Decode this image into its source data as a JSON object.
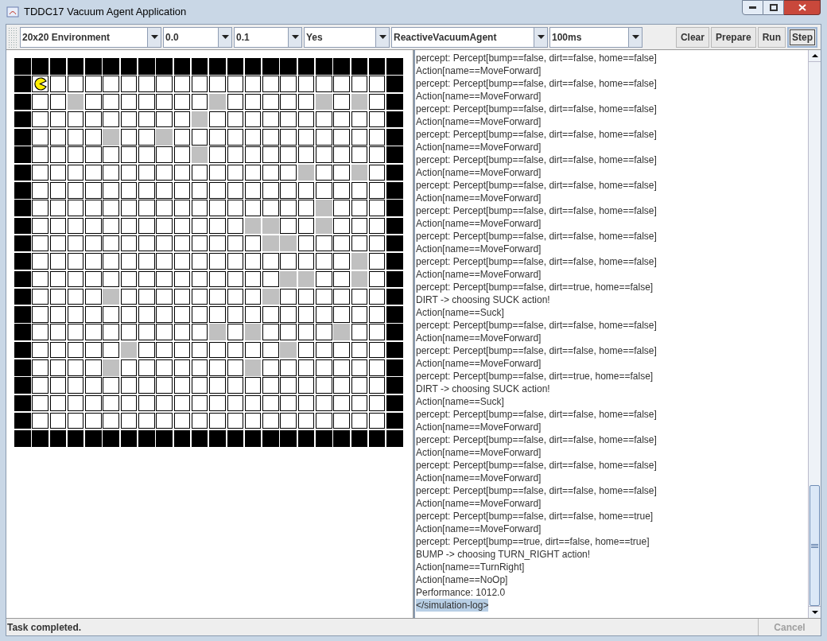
{
  "window": {
    "title": "TDDC17 Vacuum Agent Application"
  },
  "toolbar": {
    "dropdowns": [
      "20x20 Environment",
      "0.0",
      "0.1",
      "Yes",
      "ReactiveVacuumAgent",
      "100ms"
    ],
    "buttons": [
      {
        "label": "Clear",
        "focused": false
      },
      {
        "label": "Prepare",
        "focused": false
      },
      {
        "label": "Run",
        "focused": false
      },
      {
        "label": "Step",
        "focused": true
      }
    ]
  },
  "grid": {
    "rows": [
      [
        {
          "kind": "agent"
        },
        {
          "kind": "floor"
        },
        {
          "kind": "floor"
        },
        {
          "kind": "floor"
        },
        {
          "kind": "floor"
        },
        {
          "kind": "floor"
        },
        {
          "kind": "floor"
        },
        {
          "kind": "floor"
        },
        {
          "kind": "floor"
        },
        {
          "kind": "floor"
        },
        {
          "kind": "floor"
        },
        {
          "kind": "floor"
        },
        {
          "kind": "floor"
        },
        {
          "kind": "floor"
        },
        {
          "kind": "floor"
        },
        {
          "kind": "floor"
        },
        {
          "kind": "floor"
        },
        {
          "kind": "floor"
        },
        {
          "kind": "floor"
        },
        {
          "kind": "floor"
        }
      ],
      [
        {
          "kind": "floor"
        },
        {
          "kind": "floor"
        },
        {
          "kind": "dirt"
        },
        {
          "kind": "floor"
        },
        {
          "kind": "floor"
        },
        {
          "kind": "floor"
        },
        {
          "kind": "floor"
        },
        {
          "kind": "floor"
        },
        {
          "kind": "floor"
        },
        {
          "kind": "floor"
        },
        {
          "kind": "dirt"
        },
        {
          "kind": "floor"
        },
        {
          "kind": "floor"
        },
        {
          "kind": "floor"
        },
        {
          "kind": "floor"
        },
        {
          "kind": "floor"
        },
        {
          "kind": "dirt"
        },
        {
          "kind": "floor"
        },
        {
          "kind": "dirt"
        },
        {
          "kind": "floor"
        }
      ],
      [
        {
          "kind": "floor"
        },
        {
          "kind": "floor"
        },
        {
          "kind": "floor"
        },
        {
          "kind": "floor"
        },
        {
          "kind": "floor"
        },
        {
          "kind": "floor"
        },
        {
          "kind": "floor"
        },
        {
          "kind": "floor"
        },
        {
          "kind": "floor"
        },
        {
          "kind": "dirt"
        },
        {
          "kind": "floor"
        },
        {
          "kind": "floor"
        },
        {
          "kind": "floor"
        },
        {
          "kind": "floor"
        },
        {
          "kind": "floor"
        },
        {
          "kind": "floor"
        },
        {
          "kind": "floor"
        },
        {
          "kind": "floor"
        },
        {
          "kind": "floor"
        },
        {
          "kind": "floor"
        }
      ],
      [
        {
          "kind": "floor"
        },
        {
          "kind": "floor"
        },
        {
          "kind": "floor"
        },
        {
          "kind": "floor"
        },
        {
          "kind": "dirt"
        },
        {
          "kind": "floor"
        },
        {
          "kind": "floor"
        },
        {
          "kind": "dirt"
        },
        {
          "kind": "floor"
        },
        {
          "kind": "floor"
        },
        {
          "kind": "floor"
        },
        {
          "kind": "floor"
        },
        {
          "kind": "floor"
        },
        {
          "kind": "floor"
        },
        {
          "kind": "floor"
        },
        {
          "kind": "floor"
        },
        {
          "kind": "floor"
        },
        {
          "kind": "floor"
        },
        {
          "kind": "floor"
        },
        {
          "kind": "floor"
        }
      ],
      [
        {
          "kind": "floor"
        },
        {
          "kind": "floor"
        },
        {
          "kind": "floor"
        },
        {
          "kind": "floor"
        },
        {
          "kind": "floor"
        },
        {
          "kind": "floor"
        },
        {
          "kind": "floor"
        },
        {
          "kind": "floor"
        },
        {
          "kind": "floor"
        },
        {
          "kind": "dirt"
        },
        {
          "kind": "floor"
        },
        {
          "kind": "floor"
        },
        {
          "kind": "floor"
        },
        {
          "kind": "floor"
        },
        {
          "kind": "floor"
        },
        {
          "kind": "floor"
        },
        {
          "kind": "floor"
        },
        {
          "kind": "floor"
        },
        {
          "kind": "floor"
        },
        {
          "kind": "floor"
        }
      ],
      [
        {
          "kind": "floor"
        },
        {
          "kind": "floor"
        },
        {
          "kind": "floor"
        },
        {
          "kind": "floor"
        },
        {
          "kind": "floor"
        },
        {
          "kind": "floor"
        },
        {
          "kind": "floor"
        },
        {
          "kind": "floor"
        },
        {
          "kind": "floor"
        },
        {
          "kind": "floor"
        },
        {
          "kind": "floor"
        },
        {
          "kind": "floor"
        },
        {
          "kind": "floor"
        },
        {
          "kind": "floor"
        },
        {
          "kind": "floor"
        },
        {
          "kind": "dirt"
        },
        {
          "kind": "floor"
        },
        {
          "kind": "floor"
        },
        {
          "kind": "dirt"
        },
        {
          "kind": "floor"
        }
      ],
      [
        {
          "kind": "floor"
        },
        {
          "kind": "floor"
        },
        {
          "kind": "floor"
        },
        {
          "kind": "floor"
        },
        {
          "kind": "floor"
        },
        {
          "kind": "floor"
        },
        {
          "kind": "floor"
        },
        {
          "kind": "floor"
        },
        {
          "kind": "floor"
        },
        {
          "kind": "floor"
        },
        {
          "kind": "floor"
        },
        {
          "kind": "floor"
        },
        {
          "kind": "floor"
        },
        {
          "kind": "floor"
        },
        {
          "kind": "floor"
        },
        {
          "kind": "floor"
        },
        {
          "kind": "floor"
        },
        {
          "kind": "floor"
        },
        {
          "kind": "floor"
        },
        {
          "kind": "floor"
        }
      ],
      [
        {
          "kind": "floor"
        },
        {
          "kind": "floor"
        },
        {
          "kind": "floor"
        },
        {
          "kind": "floor"
        },
        {
          "kind": "floor"
        },
        {
          "kind": "floor"
        },
        {
          "kind": "floor"
        },
        {
          "kind": "floor"
        },
        {
          "kind": "floor"
        },
        {
          "kind": "floor"
        },
        {
          "kind": "floor"
        },
        {
          "kind": "floor"
        },
        {
          "kind": "floor"
        },
        {
          "kind": "floor"
        },
        {
          "kind": "floor"
        },
        {
          "kind": "floor"
        },
        {
          "kind": "dirt"
        },
        {
          "kind": "floor"
        },
        {
          "kind": "floor"
        },
        {
          "kind": "floor"
        }
      ],
      [
        {
          "kind": "floor"
        },
        {
          "kind": "floor"
        },
        {
          "kind": "floor"
        },
        {
          "kind": "floor"
        },
        {
          "kind": "floor"
        },
        {
          "kind": "floor"
        },
        {
          "kind": "floor"
        },
        {
          "kind": "floor"
        },
        {
          "kind": "floor"
        },
        {
          "kind": "floor"
        },
        {
          "kind": "floor"
        },
        {
          "kind": "floor"
        },
        {
          "kind": "dirt"
        },
        {
          "kind": "dirt"
        },
        {
          "kind": "floor"
        },
        {
          "kind": "floor"
        },
        {
          "kind": "dirt"
        },
        {
          "kind": "floor"
        },
        {
          "kind": "floor"
        },
        {
          "kind": "floor"
        }
      ],
      [
        {
          "kind": "floor"
        },
        {
          "kind": "floor"
        },
        {
          "kind": "floor"
        },
        {
          "kind": "floor"
        },
        {
          "kind": "floor"
        },
        {
          "kind": "floor"
        },
        {
          "kind": "floor"
        },
        {
          "kind": "floor"
        },
        {
          "kind": "floor"
        },
        {
          "kind": "floor"
        },
        {
          "kind": "floor"
        },
        {
          "kind": "floor"
        },
        {
          "kind": "floor"
        },
        {
          "kind": "dirt"
        },
        {
          "kind": "dirt"
        },
        {
          "kind": "floor"
        },
        {
          "kind": "floor"
        },
        {
          "kind": "floor"
        },
        {
          "kind": "floor"
        },
        {
          "kind": "floor"
        }
      ],
      [
        {
          "kind": "floor"
        },
        {
          "kind": "floor"
        },
        {
          "kind": "floor"
        },
        {
          "kind": "floor"
        },
        {
          "kind": "floor"
        },
        {
          "kind": "floor"
        },
        {
          "kind": "floor"
        },
        {
          "kind": "floor"
        },
        {
          "kind": "floor"
        },
        {
          "kind": "floor"
        },
        {
          "kind": "floor"
        },
        {
          "kind": "floor"
        },
        {
          "kind": "floor"
        },
        {
          "kind": "floor"
        },
        {
          "kind": "floor"
        },
        {
          "kind": "floor"
        },
        {
          "kind": "floor"
        },
        {
          "kind": "floor"
        },
        {
          "kind": "dirt"
        },
        {
          "kind": "floor"
        }
      ],
      [
        {
          "kind": "floor"
        },
        {
          "kind": "floor"
        },
        {
          "kind": "floor"
        },
        {
          "kind": "floor"
        },
        {
          "kind": "floor"
        },
        {
          "kind": "floor"
        },
        {
          "kind": "floor"
        },
        {
          "kind": "floor"
        },
        {
          "kind": "floor"
        },
        {
          "kind": "floor"
        },
        {
          "kind": "floor"
        },
        {
          "kind": "floor"
        },
        {
          "kind": "floor"
        },
        {
          "kind": "floor"
        },
        {
          "kind": "dirt"
        },
        {
          "kind": "dirt"
        },
        {
          "kind": "floor"
        },
        {
          "kind": "floor"
        },
        {
          "kind": "dirt"
        },
        {
          "kind": "floor"
        }
      ],
      [
        {
          "kind": "floor"
        },
        {
          "kind": "floor"
        },
        {
          "kind": "floor"
        },
        {
          "kind": "floor"
        },
        {
          "kind": "dirt"
        },
        {
          "kind": "floor"
        },
        {
          "kind": "floor"
        },
        {
          "kind": "floor"
        },
        {
          "kind": "floor"
        },
        {
          "kind": "floor"
        },
        {
          "kind": "floor"
        },
        {
          "kind": "floor"
        },
        {
          "kind": "floor"
        },
        {
          "kind": "dirt"
        },
        {
          "kind": "floor"
        },
        {
          "kind": "floor"
        },
        {
          "kind": "floor"
        },
        {
          "kind": "floor"
        },
        {
          "kind": "floor"
        },
        {
          "kind": "floor"
        }
      ],
      [
        {
          "kind": "floor"
        },
        {
          "kind": "floor"
        },
        {
          "kind": "floor"
        },
        {
          "kind": "floor"
        },
        {
          "kind": "floor"
        },
        {
          "kind": "floor"
        },
        {
          "kind": "floor"
        },
        {
          "kind": "floor"
        },
        {
          "kind": "floor"
        },
        {
          "kind": "floor"
        },
        {
          "kind": "floor"
        },
        {
          "kind": "floor"
        },
        {
          "kind": "floor"
        },
        {
          "kind": "floor"
        },
        {
          "kind": "floor"
        },
        {
          "kind": "floor"
        },
        {
          "kind": "floor"
        },
        {
          "kind": "floor"
        },
        {
          "kind": "floor"
        },
        {
          "kind": "floor"
        }
      ],
      [
        {
          "kind": "floor"
        },
        {
          "kind": "floor"
        },
        {
          "kind": "floor"
        },
        {
          "kind": "floor"
        },
        {
          "kind": "floor"
        },
        {
          "kind": "floor"
        },
        {
          "kind": "floor"
        },
        {
          "kind": "floor"
        },
        {
          "kind": "floor"
        },
        {
          "kind": "floor"
        },
        {
          "kind": "dirt"
        },
        {
          "kind": "floor"
        },
        {
          "kind": "dirt"
        },
        {
          "kind": "floor"
        },
        {
          "kind": "floor"
        },
        {
          "kind": "floor"
        },
        {
          "kind": "floor"
        },
        {
          "kind": "dirt"
        },
        {
          "kind": "floor"
        },
        {
          "kind": "floor"
        }
      ],
      [
        {
          "kind": "floor"
        },
        {
          "kind": "floor"
        },
        {
          "kind": "floor"
        },
        {
          "kind": "floor"
        },
        {
          "kind": "floor"
        },
        {
          "kind": "dirt"
        },
        {
          "kind": "floor"
        },
        {
          "kind": "floor"
        },
        {
          "kind": "floor"
        },
        {
          "kind": "floor"
        },
        {
          "kind": "floor"
        },
        {
          "kind": "floor"
        },
        {
          "kind": "floor"
        },
        {
          "kind": "floor"
        },
        {
          "kind": "dirt"
        },
        {
          "kind": "floor"
        },
        {
          "kind": "floor"
        },
        {
          "kind": "floor"
        },
        {
          "kind": "floor"
        },
        {
          "kind": "floor"
        }
      ],
      [
        {
          "kind": "floor"
        },
        {
          "kind": "floor"
        },
        {
          "kind": "floor"
        },
        {
          "kind": "floor"
        },
        {
          "kind": "dirt"
        },
        {
          "kind": "floor"
        },
        {
          "kind": "floor"
        },
        {
          "kind": "floor"
        },
        {
          "kind": "floor"
        },
        {
          "kind": "floor"
        },
        {
          "kind": "floor"
        },
        {
          "kind": "floor"
        },
        {
          "kind": "dirt"
        },
        {
          "kind": "floor"
        },
        {
          "kind": "floor"
        },
        {
          "kind": "floor"
        },
        {
          "kind": "floor"
        },
        {
          "kind": "floor"
        },
        {
          "kind": "floor"
        },
        {
          "kind": "floor"
        }
      ],
      [
        {
          "kind": "floor"
        },
        {
          "kind": "floor"
        },
        {
          "kind": "floor"
        },
        {
          "kind": "floor"
        },
        {
          "kind": "floor"
        },
        {
          "kind": "floor"
        },
        {
          "kind": "floor"
        },
        {
          "kind": "floor"
        },
        {
          "kind": "floor"
        },
        {
          "kind": "floor"
        },
        {
          "kind": "floor"
        },
        {
          "kind": "floor"
        },
        {
          "kind": "floor"
        },
        {
          "kind": "floor"
        },
        {
          "kind": "floor"
        },
        {
          "kind": "floor"
        },
        {
          "kind": "floor"
        },
        {
          "kind": "floor"
        },
        {
          "kind": "floor"
        },
        {
          "kind": "floor"
        }
      ],
      [
        {
          "kind": "floor"
        },
        {
          "kind": "floor"
        },
        {
          "kind": "floor"
        },
        {
          "kind": "floor"
        },
        {
          "kind": "floor"
        },
        {
          "kind": "floor"
        },
        {
          "kind": "floor"
        },
        {
          "kind": "floor"
        },
        {
          "kind": "floor"
        },
        {
          "kind": "floor"
        },
        {
          "kind": "floor"
        },
        {
          "kind": "floor"
        },
        {
          "kind": "floor"
        },
        {
          "kind": "floor"
        },
        {
          "kind": "floor"
        },
        {
          "kind": "floor"
        },
        {
          "kind": "floor"
        },
        {
          "kind": "floor"
        },
        {
          "kind": "floor"
        },
        {
          "kind": "floor"
        }
      ],
      [
        {
          "kind": "floor"
        },
        {
          "kind": "floor"
        },
        {
          "kind": "floor"
        },
        {
          "kind": "floor"
        },
        {
          "kind": "floor"
        },
        {
          "kind": "floor"
        },
        {
          "kind": "floor"
        },
        {
          "kind": "floor"
        },
        {
          "kind": "floor"
        },
        {
          "kind": "floor"
        },
        {
          "kind": "floor"
        },
        {
          "kind": "floor"
        },
        {
          "kind": "floor"
        },
        {
          "kind": "floor"
        },
        {
          "kind": "floor"
        },
        {
          "kind": "floor"
        },
        {
          "kind": "floor"
        },
        {
          "kind": "floor"
        },
        {
          "kind": "floor"
        },
        {
          "kind": "floor"
        }
      ]
    ]
  },
  "log": {
    "lines": [
      {
        "text": "percept: Percept[bump==false, dirt==false, home==false]",
        "selected": false
      },
      {
        "text": "Action[name==MoveForward]",
        "selected": false
      },
      {
        "text": "percept: Percept[bump==false, dirt==false, home==false]",
        "selected": false
      },
      {
        "text": "Action[name==MoveForward]",
        "selected": false
      },
      {
        "text": "percept: Percept[bump==false, dirt==false, home==false]",
        "selected": false
      },
      {
        "text": "Action[name==MoveForward]",
        "selected": false
      },
      {
        "text": "percept: Percept[bump==false, dirt==false, home==false]",
        "selected": false
      },
      {
        "text": "Action[name==MoveForward]",
        "selected": false
      },
      {
        "text": "percept: Percept[bump==false, dirt==false, home==false]",
        "selected": false
      },
      {
        "text": "Action[name==MoveForward]",
        "selected": false
      },
      {
        "text": "percept: Percept[bump==false, dirt==false, home==false]",
        "selected": false
      },
      {
        "text": "Action[name==MoveForward]",
        "selected": false
      },
      {
        "text": "percept: Percept[bump==false, dirt==false, home==false]",
        "selected": false
      },
      {
        "text": "Action[name==MoveForward]",
        "selected": false
      },
      {
        "text": "percept: Percept[bump==false, dirt==false, home==false]",
        "selected": false
      },
      {
        "text": "Action[name==MoveForward]",
        "selected": false
      },
      {
        "text": "percept: Percept[bump==false, dirt==false, home==false]",
        "selected": false
      },
      {
        "text": "Action[name==MoveForward]",
        "selected": false
      },
      {
        "text": "percept: Percept[bump==false, dirt==true, home==false]",
        "selected": false
      },
      {
        "text": "DIRT -> choosing SUCK action!",
        "selected": false
      },
      {
        "text": "Action[name==Suck]",
        "selected": false
      },
      {
        "text": "percept: Percept[bump==false, dirt==false, home==false]",
        "selected": false
      },
      {
        "text": "Action[name==MoveForward]",
        "selected": false
      },
      {
        "text": "percept: Percept[bump==false, dirt==false, home==false]",
        "selected": false
      },
      {
        "text": "Action[name==MoveForward]",
        "selected": false
      },
      {
        "text": "percept: Percept[bump==false, dirt==true, home==false]",
        "selected": false
      },
      {
        "text": "DIRT -> choosing SUCK action!",
        "selected": false
      },
      {
        "text": "Action[name==Suck]",
        "selected": false
      },
      {
        "text": "percept: Percept[bump==false, dirt==false, home==false]",
        "selected": false
      },
      {
        "text": "Action[name==MoveForward]",
        "selected": false
      },
      {
        "text": "percept: Percept[bump==false, dirt==false, home==false]",
        "selected": false
      },
      {
        "text": "Action[name==MoveForward]",
        "selected": false
      },
      {
        "text": "percept: Percept[bump==false, dirt==false, home==false]",
        "selected": false
      },
      {
        "text": "Action[name==MoveForward]",
        "selected": false
      },
      {
        "text": "percept: Percept[bump==false, dirt==false, home==false]",
        "selected": false
      },
      {
        "text": "Action[name==MoveForward]",
        "selected": false
      },
      {
        "text": "percept: Percept[bump==false, dirt==false, home==true]",
        "selected": false
      },
      {
        "text": "Action[name==MoveForward]",
        "selected": false
      },
      {
        "text": "percept: Percept[bump==true, dirt==false, home==true]",
        "selected": false
      },
      {
        "text": "BUMP -> choosing TURN_RIGHT action!",
        "selected": false
      },
      {
        "text": "Action[name==TurnRight]",
        "selected": false
      },
      {
        "text": "Action[name==NoOp]",
        "selected": false
      },
      {
        "text": "Performance: 1012.0",
        "selected": false
      },
      {
        "text": "</simulation-log>",
        "selected": true
      }
    ]
  },
  "status_bar": {
    "text": "Task completed.",
    "cancel": {
      "label": "Cancel",
      "disabled": true
    }
  }
}
